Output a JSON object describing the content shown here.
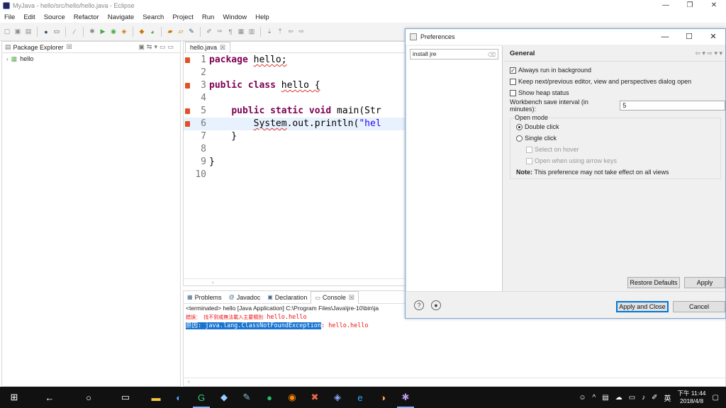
{
  "window": {
    "title": "MyJava - hello/src/hello/hello.java - Eclipse",
    "minimize": "—",
    "restore": "❐",
    "close": "✕"
  },
  "menu": [
    "File",
    "Edit",
    "Source",
    "Refactor",
    "Navigate",
    "Search",
    "Project",
    "Run",
    "Window",
    "Help"
  ],
  "package_explorer": {
    "tab_label": "Package Explorer",
    "tab_close": "☒",
    "items": [
      {
        "label": "hello",
        "icon": "project-icon",
        "expanded": false
      }
    ]
  },
  "editor": {
    "tab_label": "hello.java",
    "tab_close": "☒",
    "lines": [
      {
        "num": "1",
        "text": "package hello;"
      },
      {
        "num": "2",
        "text": ""
      },
      {
        "num": "3",
        "text": "public class hello {"
      },
      {
        "num": "4",
        "text": ""
      },
      {
        "num": "5",
        "text": "    public static void main(Str"
      },
      {
        "num": "6",
        "text": "        System.out.println(\"hel"
      },
      {
        "num": "7",
        "text": "    }"
      },
      {
        "num": "8",
        "text": ""
      },
      {
        "num": "9",
        "text": "}"
      },
      {
        "num": "10",
        "text": ""
      }
    ]
  },
  "console": {
    "tabs": [
      {
        "label": "Problems",
        "icon": "problems-icon",
        "active": false
      },
      {
        "label": "Javadoc",
        "icon": "javadoc-icon",
        "active": false
      },
      {
        "label": "Declaration",
        "icon": "declaration-icon",
        "active": false
      },
      {
        "label": "Console",
        "icon": "console-icon",
        "active": true
      }
    ],
    "console_close": "☒",
    "terminated": "<terminated> hello [Java Application] C:\\Program Files\\Java\\jre-10\\bin\\ja",
    "line1_prefix": "錯誤： 找不到或無法載入主要類別",
    "line1_suffix": " hello.hello",
    "line2_prefix": "原因:",
    "line2_selected": " java.lang.ClassNotFoundException",
    "line2_suffix": ": hello.hello"
  },
  "preferences": {
    "title": "Preferences",
    "filter_value": "install jre",
    "section_title": "General",
    "options": [
      {
        "label": "Always run in background",
        "checked": true
      },
      {
        "label": "Keep next/previous editor, view and perspectives dialog open",
        "checked": false
      },
      {
        "label": "Show heap status",
        "checked": false
      }
    ],
    "workbench_label": "Workbench save interval (in minutes):",
    "workbench_value": "5",
    "open_mode_title": "Open mode",
    "open_mode": [
      {
        "label": "Double click",
        "selected": true
      },
      {
        "label": "Single click",
        "selected": false
      }
    ],
    "sub_options": [
      "Select on hover",
      "Open when using arrow keys"
    ],
    "note_label": "Note:",
    "note_text": "This preference may not take effect on all views",
    "restore_defaults": "Restore Defaults",
    "apply": "Apply",
    "apply_close": "Apply and Close",
    "cancel": "Cancel"
  },
  "taskbar": {
    "clock_time": "下午 11:44",
    "clock_date": "2018/4/8",
    "ime": "英"
  }
}
